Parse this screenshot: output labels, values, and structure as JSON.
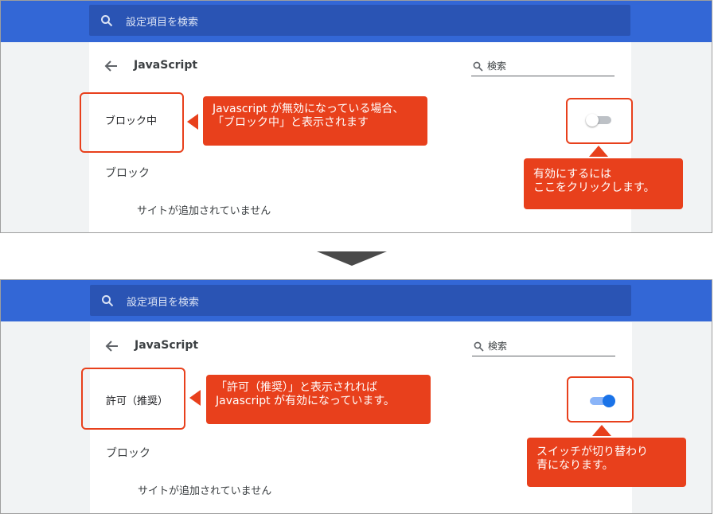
{
  "colors": {
    "topbar": "#3367d6",
    "search_field": "#2a54b4",
    "callout": "#e8401c",
    "toggle_on": "#1a73e8",
    "toggle_off": "#bdc1c6"
  },
  "before": {
    "search_placeholder": "設定項目を検索",
    "back_icon": "arrow-left-icon",
    "site_title": "JavaScript",
    "card_search_label": "検索",
    "status_label": "ブロック中",
    "block_heading": "ブロック",
    "empty_message": "サイトが追加されていません",
    "toggle_state": "off",
    "callout_status": [
      "Javascript が無効になっている場合、",
      "「ブロック中」と表示されます"
    ],
    "callout_toggle": [
      "有効にするには",
      "ここをクリックします。"
    ]
  },
  "after": {
    "search_placeholder": "設定項目を検索",
    "back_icon": "arrow-left-icon",
    "site_title": "JavaScript",
    "card_search_label": "検索",
    "status_label": "許可（推奨）",
    "block_heading": "ブロック",
    "empty_message": "サイトが追加されていません",
    "toggle_state": "on",
    "callout_status": [
      "「許可（推奨）」と表示されれば",
      "Javascript が有効になっています。"
    ],
    "callout_toggle": [
      "スイッチが切り替わり",
      "青になります。"
    ]
  }
}
